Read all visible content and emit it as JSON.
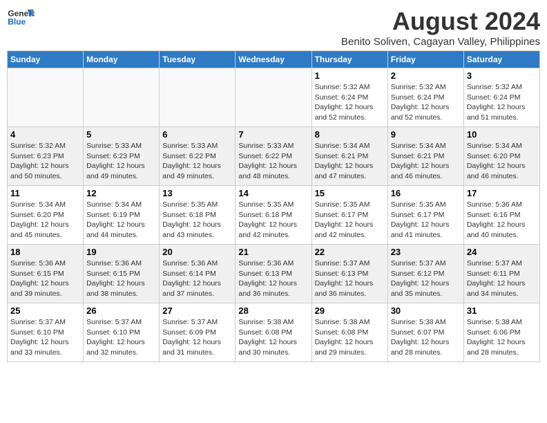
{
  "logo": {
    "general": "General",
    "blue": "Blue"
  },
  "title": "August 2024",
  "subtitle": "Benito Soliven, Cagayan Valley, Philippines",
  "days_of_week": [
    "Sunday",
    "Monday",
    "Tuesday",
    "Wednesday",
    "Thursday",
    "Friday",
    "Saturday"
  ],
  "weeks": [
    [
      {
        "day": "",
        "info": ""
      },
      {
        "day": "",
        "info": ""
      },
      {
        "day": "",
        "info": ""
      },
      {
        "day": "",
        "info": ""
      },
      {
        "day": "1",
        "info": "Sunrise: 5:32 AM\nSunset: 6:24 PM\nDaylight: 12 hours\nand 52 minutes."
      },
      {
        "day": "2",
        "info": "Sunrise: 5:32 AM\nSunset: 6:24 PM\nDaylight: 12 hours\nand 52 minutes."
      },
      {
        "day": "3",
        "info": "Sunrise: 5:32 AM\nSunset: 6:24 PM\nDaylight: 12 hours\nand 51 minutes."
      }
    ],
    [
      {
        "day": "4",
        "info": "Sunrise: 5:32 AM\nSunset: 6:23 PM\nDaylight: 12 hours\nand 50 minutes."
      },
      {
        "day": "5",
        "info": "Sunrise: 5:33 AM\nSunset: 6:23 PM\nDaylight: 12 hours\nand 49 minutes."
      },
      {
        "day": "6",
        "info": "Sunrise: 5:33 AM\nSunset: 6:22 PM\nDaylight: 12 hours\nand 49 minutes."
      },
      {
        "day": "7",
        "info": "Sunrise: 5:33 AM\nSunset: 6:22 PM\nDaylight: 12 hours\nand 48 minutes."
      },
      {
        "day": "8",
        "info": "Sunrise: 5:34 AM\nSunset: 6:21 PM\nDaylight: 12 hours\nand 47 minutes."
      },
      {
        "day": "9",
        "info": "Sunrise: 5:34 AM\nSunset: 6:21 PM\nDaylight: 12 hours\nand 46 minutes."
      },
      {
        "day": "10",
        "info": "Sunrise: 5:34 AM\nSunset: 6:20 PM\nDaylight: 12 hours\nand 46 minutes."
      }
    ],
    [
      {
        "day": "11",
        "info": "Sunrise: 5:34 AM\nSunset: 6:20 PM\nDaylight: 12 hours\nand 45 minutes."
      },
      {
        "day": "12",
        "info": "Sunrise: 5:34 AM\nSunset: 6:19 PM\nDaylight: 12 hours\nand 44 minutes."
      },
      {
        "day": "13",
        "info": "Sunrise: 5:35 AM\nSunset: 6:18 PM\nDaylight: 12 hours\nand 43 minutes."
      },
      {
        "day": "14",
        "info": "Sunrise: 5:35 AM\nSunset: 6:18 PM\nDaylight: 12 hours\nand 42 minutes."
      },
      {
        "day": "15",
        "info": "Sunrise: 5:35 AM\nSunset: 6:17 PM\nDaylight: 12 hours\nand 42 minutes."
      },
      {
        "day": "16",
        "info": "Sunrise: 5:35 AM\nSunset: 6:17 PM\nDaylight: 12 hours\nand 41 minutes."
      },
      {
        "day": "17",
        "info": "Sunrise: 5:36 AM\nSunset: 6:16 PM\nDaylight: 12 hours\nand 40 minutes."
      }
    ],
    [
      {
        "day": "18",
        "info": "Sunrise: 5:36 AM\nSunset: 6:15 PM\nDaylight: 12 hours\nand 39 minutes."
      },
      {
        "day": "19",
        "info": "Sunrise: 5:36 AM\nSunset: 6:15 PM\nDaylight: 12 hours\nand 38 minutes."
      },
      {
        "day": "20",
        "info": "Sunrise: 5:36 AM\nSunset: 6:14 PM\nDaylight: 12 hours\nand 37 minutes."
      },
      {
        "day": "21",
        "info": "Sunrise: 5:36 AM\nSunset: 6:13 PM\nDaylight: 12 hours\nand 36 minutes."
      },
      {
        "day": "22",
        "info": "Sunrise: 5:37 AM\nSunset: 6:13 PM\nDaylight: 12 hours\nand 36 minutes."
      },
      {
        "day": "23",
        "info": "Sunrise: 5:37 AM\nSunset: 6:12 PM\nDaylight: 12 hours\nand 35 minutes."
      },
      {
        "day": "24",
        "info": "Sunrise: 5:37 AM\nSunset: 6:11 PM\nDaylight: 12 hours\nand 34 minutes."
      }
    ],
    [
      {
        "day": "25",
        "info": "Sunrise: 5:37 AM\nSunset: 6:10 PM\nDaylight: 12 hours\nand 33 minutes."
      },
      {
        "day": "26",
        "info": "Sunrise: 5:37 AM\nSunset: 6:10 PM\nDaylight: 12 hours\nand 32 minutes."
      },
      {
        "day": "27",
        "info": "Sunrise: 5:37 AM\nSunset: 6:09 PM\nDaylight: 12 hours\nand 31 minutes."
      },
      {
        "day": "28",
        "info": "Sunrise: 5:38 AM\nSunset: 6:08 PM\nDaylight: 12 hours\nand 30 minutes."
      },
      {
        "day": "29",
        "info": "Sunrise: 5:38 AM\nSunset: 6:08 PM\nDaylight: 12 hours\nand 29 minutes."
      },
      {
        "day": "30",
        "info": "Sunrise: 5:38 AM\nSunset: 6:07 PM\nDaylight: 12 hours\nand 28 minutes."
      },
      {
        "day": "31",
        "info": "Sunrise: 5:38 AM\nSunset: 6:06 PM\nDaylight: 12 hours\nand 28 minutes."
      }
    ]
  ]
}
